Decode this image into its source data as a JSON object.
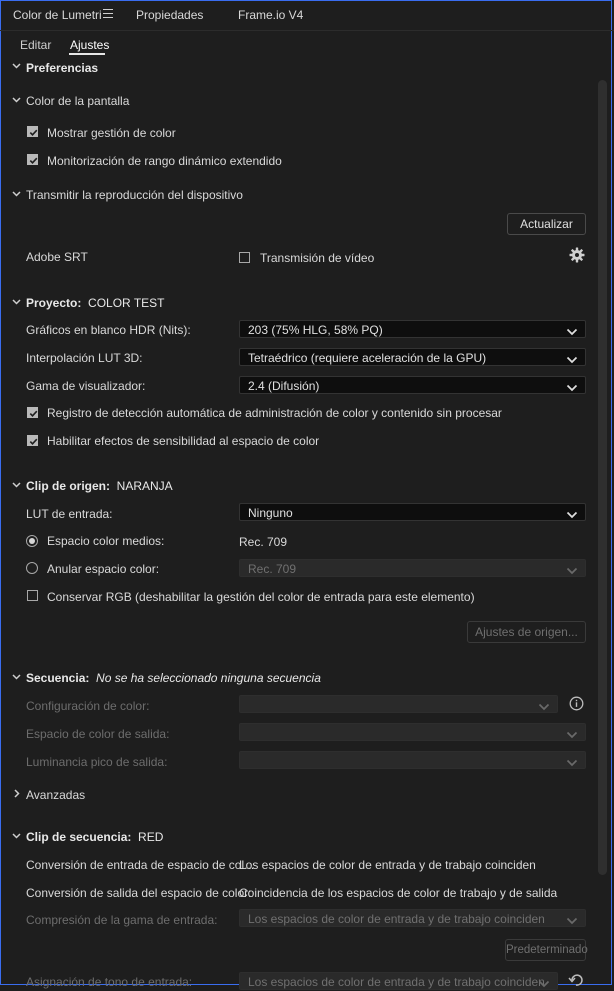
{
  "tabs": {
    "lumetri": "Color de Lumetri",
    "properties": "Propiedades",
    "frameio": "Frame.io V4"
  },
  "subtabs": {
    "edit": "Editar",
    "settings": "Ajustes"
  },
  "preferences": {
    "title": "Preferencias",
    "display_color": {
      "title": "Color de la pantalla",
      "show_color_mgmt": "Mostrar gestión de color",
      "extended_range": "Monitorización de rango dinámico extendido"
    },
    "stream": {
      "title": "Transmitir la reproducción del dispositivo",
      "update_button": "Actualizar",
      "adobe_srt": "Adobe SRT",
      "video_stream": "Transmisión de vídeo"
    }
  },
  "project": {
    "title": "Proyecto:",
    "name": "COLOR TEST",
    "hdr_label": "Gráficos en blanco HDR (Nits):",
    "hdr_value": "203 (75% HLG, 58% PQ)",
    "lut_interp_label": "Interpolación LUT 3D:",
    "lut_interp_value": "Tetraédrico (requiere aceleración de la GPU)",
    "gamma_label": "Gama de visualizador:",
    "gamma_value": "2.4 (Difusión)",
    "auto_detect": "Registro de detección automática de administración de color y contenido sin procesar",
    "sensitivity": "Habilitar efectos de sensibilidad al espacio de color"
  },
  "source_clip": {
    "title": "Clip de origen:",
    "name": "NARANJA",
    "lut_label": "LUT de entrada:",
    "lut_value": "Ninguno",
    "media_space_label": "Espacio color medios:",
    "media_space_value": "Rec. 709",
    "override_label": "Anular espacio color:",
    "override_value": "Rec. 709",
    "preserve_rgb": "Conservar RGB (deshabilitar la gestión del color de entrada para este elemento)",
    "source_settings_button": "Ajustes de origen..."
  },
  "sequence": {
    "title": "Secuencia:",
    "subtitle": "No se ha seleccionado ninguna secuencia",
    "color_config": "Configuración de color:",
    "output_space": "Espacio de color de salida:",
    "peak_luminance": "Luminancia pico de salida:"
  },
  "advanced": {
    "title": "Avanzadas"
  },
  "seq_clip": {
    "title": "Clip de secuencia:",
    "name": "RED",
    "input_conv_label": "Conversión de entrada de espacio de col...",
    "input_conv_value": "Los espacios de color de entrada y de trabajo coinciden",
    "output_conv_label": "Conversión de salida del espacio de color:",
    "output_conv_value": "Coincidencia de los espacios de color de trabajo y de salida",
    "gamut_label": "Compresión de la gama de entrada:",
    "gamut_value": "Los espacios de color de entrada y de trabajo coinciden",
    "default_button": "Predeterminado",
    "tone_label": "Asignación de tono de entrada:",
    "tone_value": "Los espacios de color de entrada y de trabajo coinciden"
  },
  "colors": {
    "accent": "#3a6df0",
    "bg": "#1e1e1e",
    "field": "#0e0e0e"
  }
}
